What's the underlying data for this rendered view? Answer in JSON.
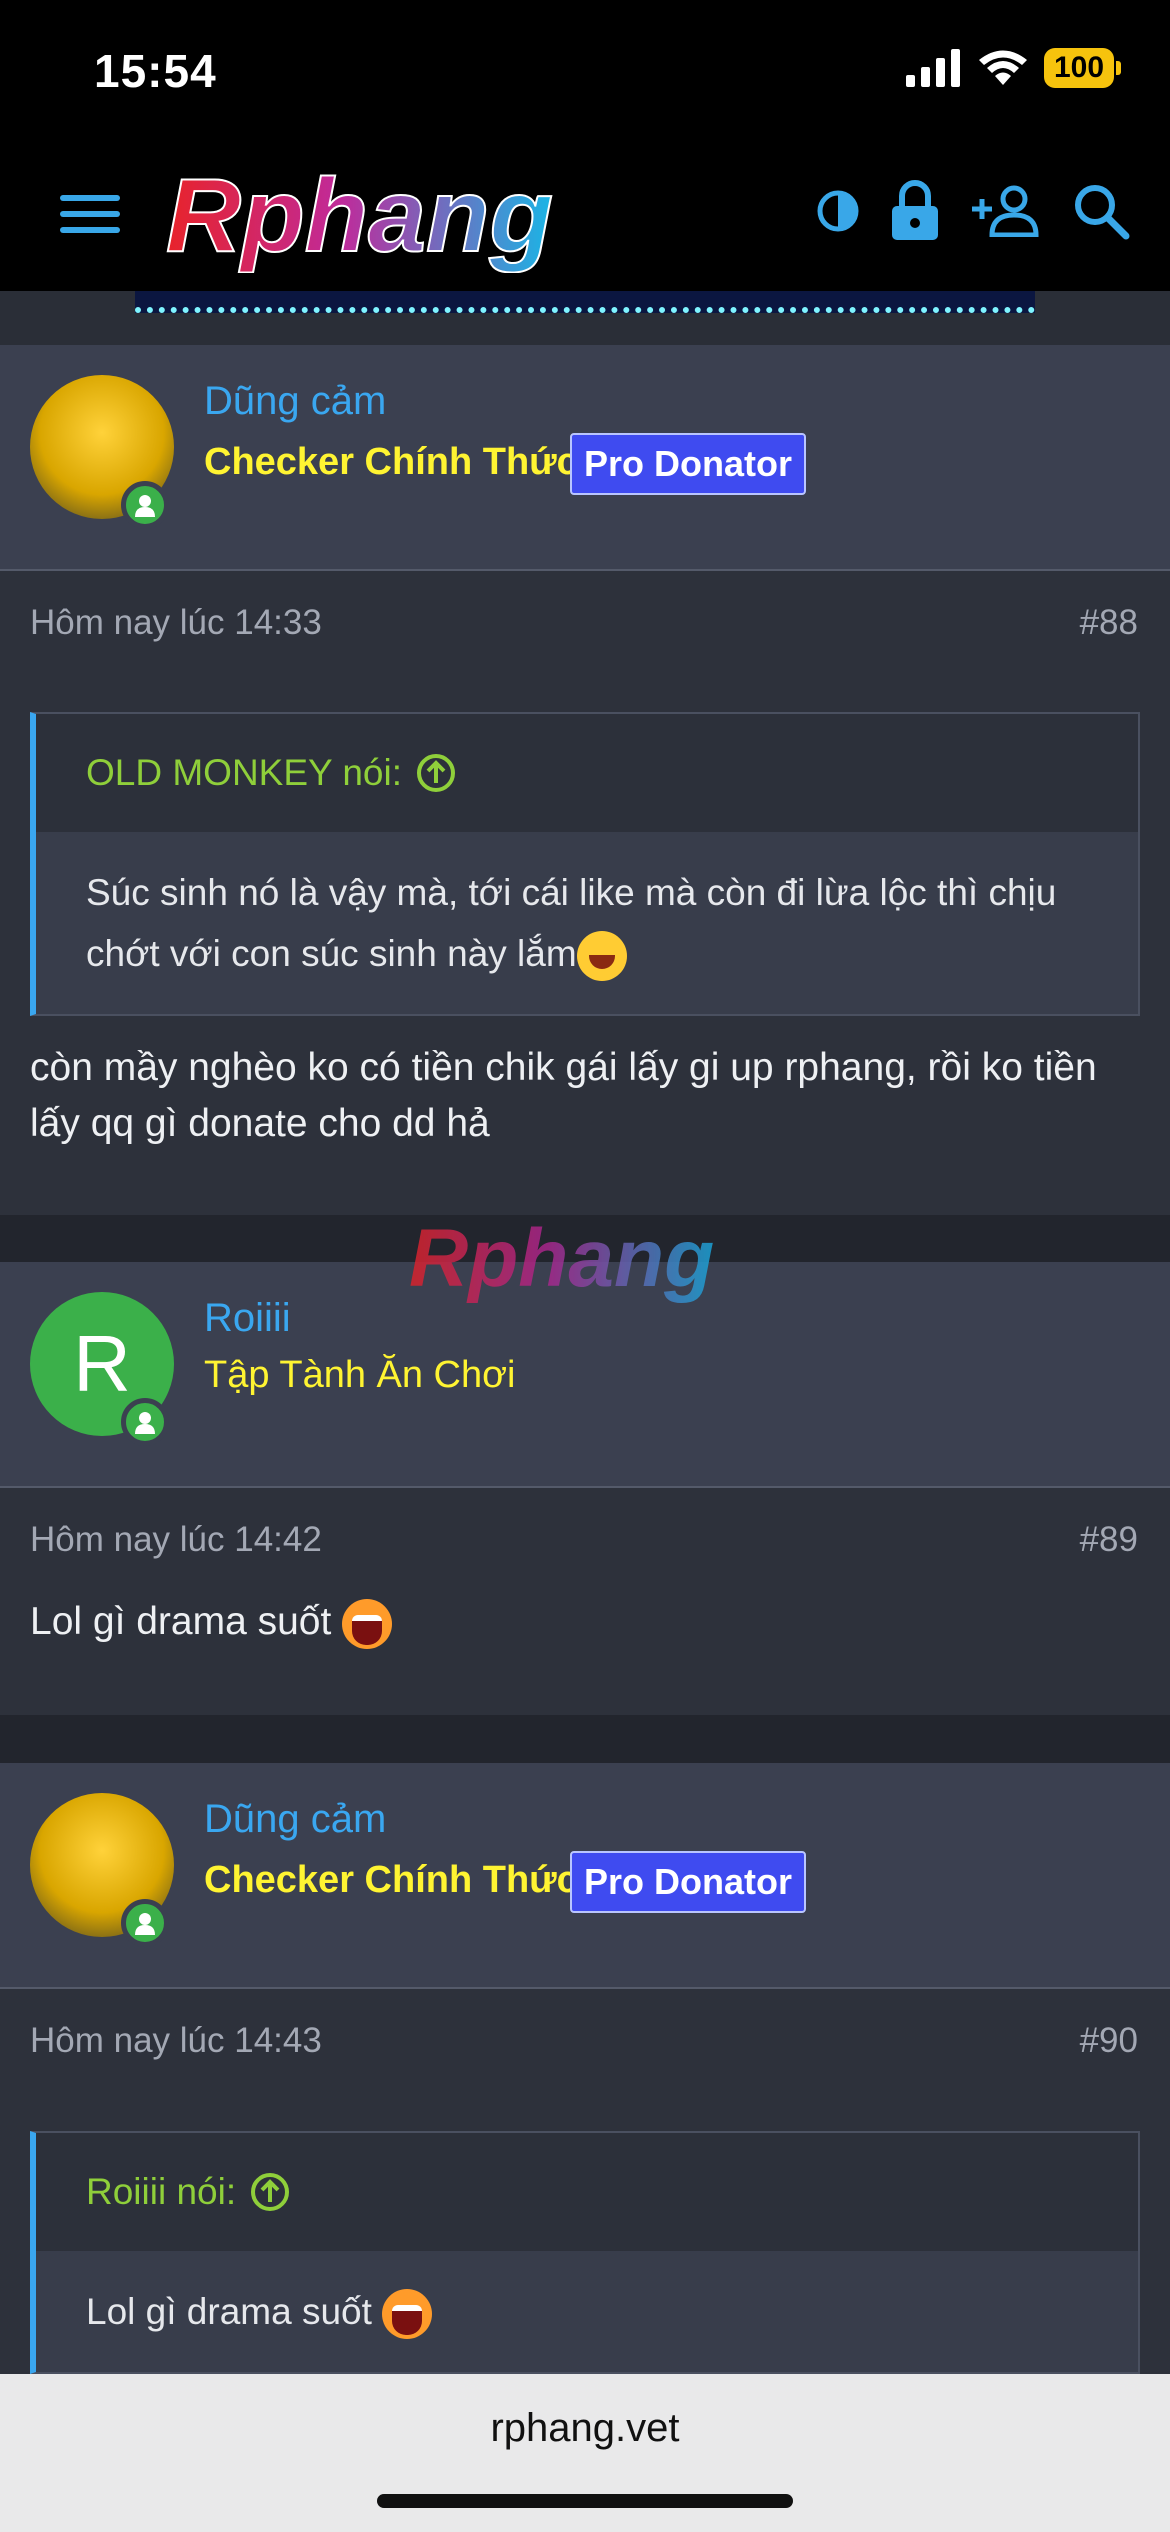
{
  "status_bar": {
    "time": "15:54",
    "battery": "100"
  },
  "header": {
    "logo_text": "Rphang",
    "icons": [
      "menu-icon",
      "contrast-icon",
      "lock-icon",
      "add-user-icon",
      "search-icon"
    ]
  },
  "posts": [
    {
      "username": "Dũng cảm",
      "title": "Checker Chính Thức",
      "badge": "Pro Donator",
      "time": "Hôm nay lúc 14:33",
      "number": "#88",
      "quote_author": "OLD MONKEY nói:",
      "quote_text": "Súc sinh nó là vậy mà, tới cái like mà còn đi lừa lộc thì chịu chớt với con súc sinh này lắm",
      "text": "còn mầy nghèo ko có tiền chik gái lấy gi up rphang, rồi ko tiền lấy qq gì donate cho dd hả"
    },
    {
      "username": "Roiiii",
      "title": "Tập Tành Ăn Chơi",
      "avatar_letter": "R",
      "time": "Hôm nay lúc 14:42",
      "number": "#89",
      "text": "Lol gì drama suốt"
    },
    {
      "username": "Dũng cảm",
      "title": "Checker Chính Thức",
      "badge": "Pro Donator",
      "time": "Hôm nay lúc 14:43",
      "number": "#90",
      "quote_author": "Roiiii nói:",
      "quote_text": "Lol gì drama suốt"
    }
  ],
  "watermark_text": "Rphang",
  "url_bar": {
    "url": "rphang.vet"
  },
  "colors": {
    "accent_blue": "#3aa7f0",
    "title_yellow": "#fff432",
    "quote_green": "#8fcf3a",
    "badge_blue": "#3f4bf0",
    "online_green": "#3bb04a"
  }
}
